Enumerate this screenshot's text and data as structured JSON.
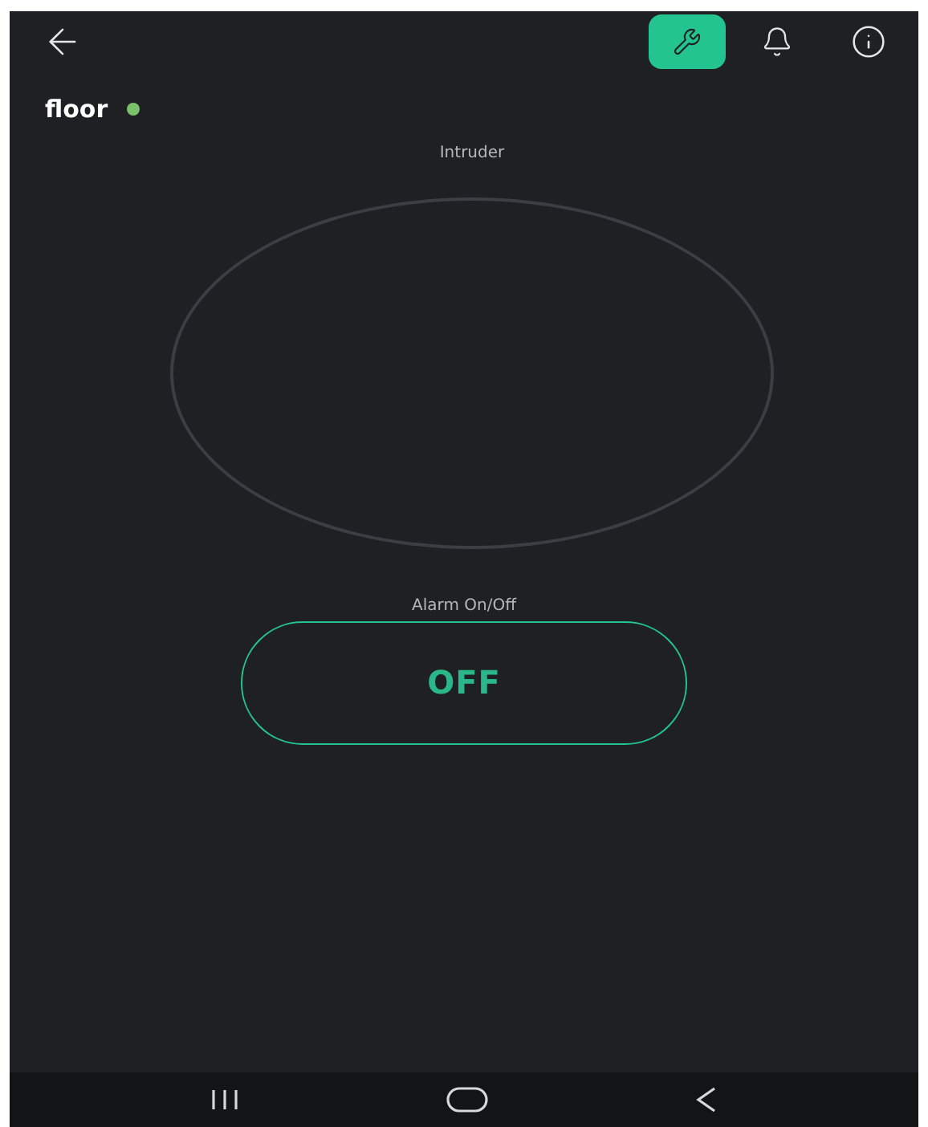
{
  "header": {
    "tools_active": true
  },
  "device": {
    "name": "floor",
    "online": true
  },
  "widgets": [
    {
      "kind": "gauge",
      "label": "Intruder"
    },
    {
      "kind": "switch",
      "label": "Alarm On/Off",
      "value": "OFF",
      "on": false
    }
  ]
}
